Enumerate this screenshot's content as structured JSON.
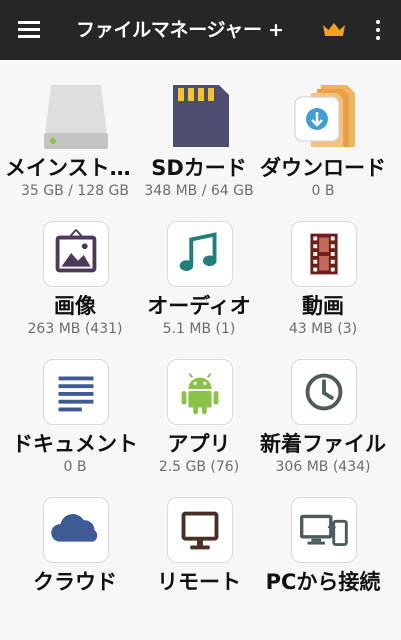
{
  "header": {
    "title": "ファイルマネージャー +",
    "menu_icon": "hamburger-menu-icon",
    "premium_icon": "crown-icon",
    "more_icon": "more-vert-icon",
    "accent_color": "#f3a21f"
  },
  "tiles": [
    {
      "label": "メインストレージ",
      "sub": "35 GB / 128 GB",
      "icon": "hard-drive-icon"
    },
    {
      "label": "SDカード",
      "sub": "348 MB / 64 GB",
      "icon": "sd-card-icon"
    },
    {
      "label": "ダウンロード",
      "sub": "0 B",
      "icon": "download-folder-icon"
    },
    {
      "label": "画像",
      "sub": "263 MB (431)",
      "icon": "image-icon"
    },
    {
      "label": "オーディオ",
      "sub": "5.1 MB (1)",
      "icon": "music-note-icon"
    },
    {
      "label": "動画",
      "sub": "43 MB (3)",
      "icon": "film-icon"
    },
    {
      "label": "ドキュメント",
      "sub": "0 B",
      "icon": "document-icon"
    },
    {
      "label": "アプリ",
      "sub": "2.5 GB (76)",
      "icon": "android-icon"
    },
    {
      "label": "新着ファイル",
      "sub": "306 MB (434)",
      "icon": "clock-icon"
    },
    {
      "label": "クラウド",
      "sub": "",
      "icon": "cloud-icon"
    },
    {
      "label": "リモート",
      "sub": "",
      "icon": "monitor-icon"
    },
    {
      "label": "PCから接続",
      "sub": "",
      "icon": "pc-connect-icon"
    }
  ]
}
